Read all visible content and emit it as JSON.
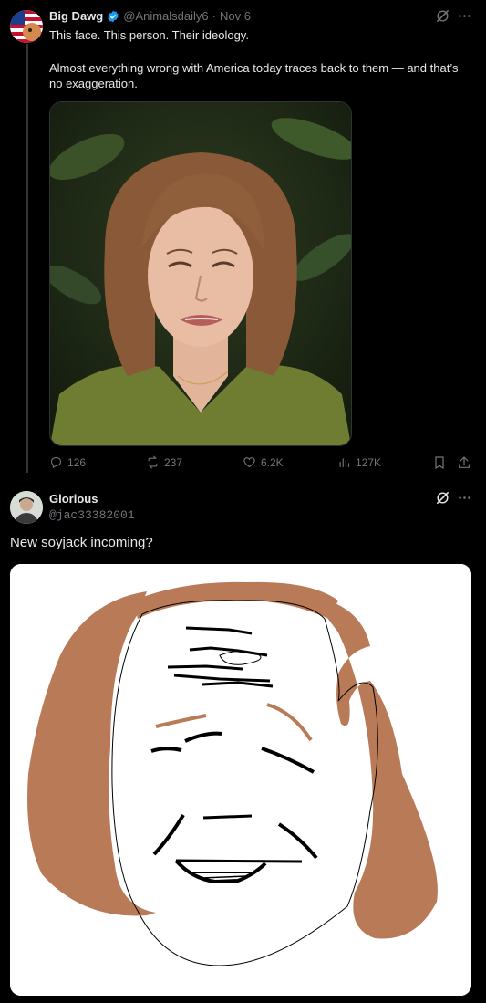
{
  "tweet1": {
    "display_name": "Big Dawg",
    "handle": "@Animalsdaily6",
    "date_sep": "·",
    "date": "Nov 6",
    "line1": "This face. This person. Their ideology.",
    "line2": "Almost everything wrong with America today traces back to them — and that’s no exaggeration.",
    "stats": {
      "replies": "126",
      "reposts": "237",
      "likes": "6.2K",
      "views": "127K"
    }
  },
  "tweet2": {
    "display_name": "Glorious",
    "handle": "@jac33382001",
    "text": "New soyjack incoming?"
  },
  "colors": {
    "background": "#000000",
    "muted": "#71767b",
    "verified": "#1d9bf0",
    "hair_paint": "#b97a57"
  }
}
